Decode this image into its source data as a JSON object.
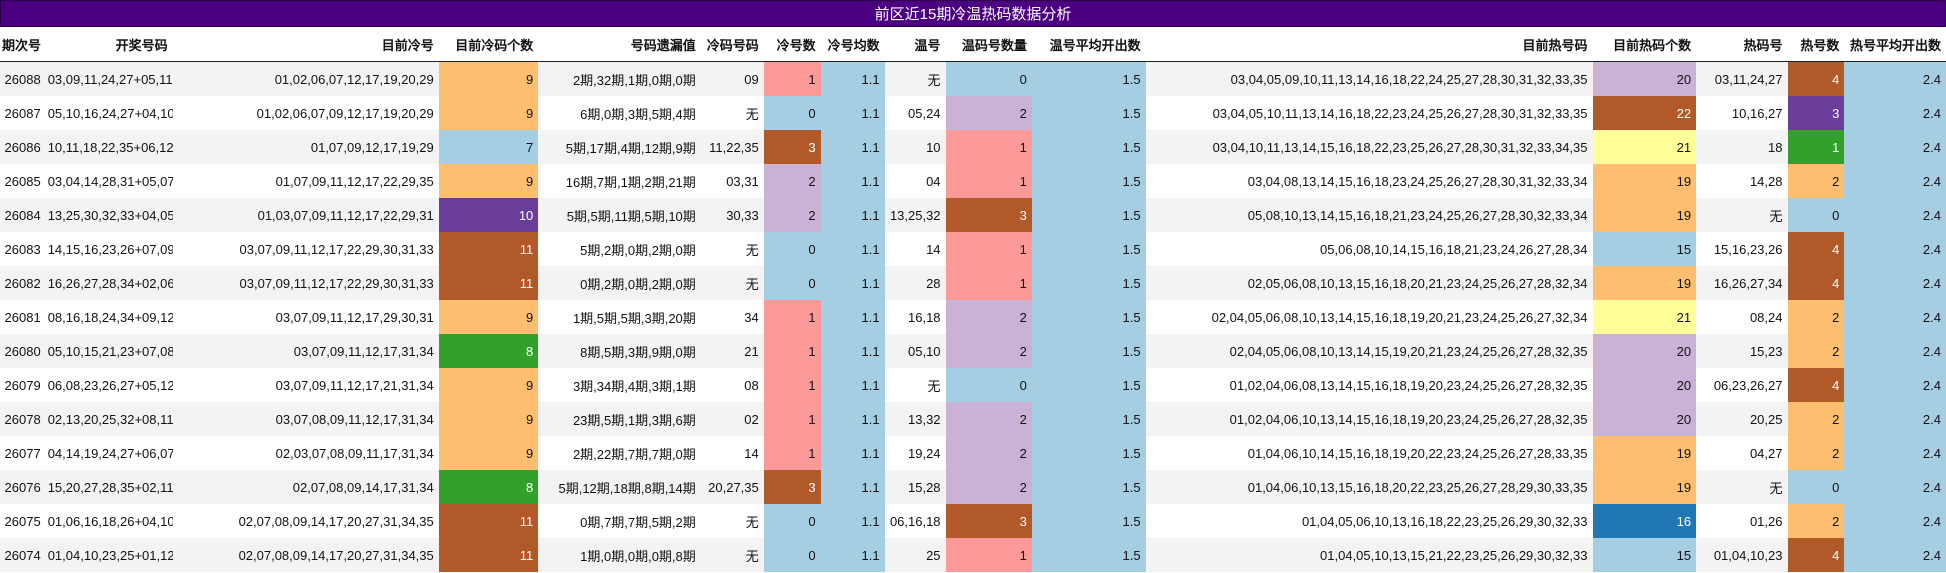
{
  "title": "前区近15期冷温热码数据分析",
  "headers": [
    "期次号",
    "开奖号码",
    "目前冷号",
    "目前冷码个数",
    "号码遗漏值",
    "冷码号码",
    "冷号数",
    "冷号均数",
    "温号",
    "温码号数量",
    "温号平均开出数",
    "目前热号码",
    "目前热码个数",
    "热码号",
    "热号数",
    "热号平均开出数"
  ],
  "colors": {
    "orange": "#fdbf6f",
    "light_blue": "#a6cee3",
    "purple": "#6a3d9a",
    "brown": "#b15928",
    "green": "#33a02c",
    "pink": "#fb9a99",
    "lavender": "#cab2d6",
    "yellow": "#ffff99",
    "blue": "#1f78b4"
  },
  "rows": [
    {
      "period": "26088",
      "draw": "03,09,11,24,27+05,11",
      "cold_nums": "01,02,06,07,12,17,19,20,29",
      "cold_count": "9",
      "cold_count_color": "orange",
      "miss": "2期,32期,1期,0期,0期",
      "cold_hit": "09",
      "cold_hit_count": "1",
      "cold_hit_color": "pink",
      "cold_avg": "1.1",
      "warm": "无",
      "warm_count": "0",
      "warm_color": "light_blue",
      "warm_avg": "1.5",
      "hot_nums": "03,04,05,09,10,11,13,14,16,18,22,24,25,27,28,30,31,32,33,35",
      "hot_count": "20",
      "hot_count_color": "lavender",
      "hot_hit": "03,11,24,27",
      "hot_hit_count": "4",
      "hot_hit_color": "brown",
      "hot_avg": "2.4"
    },
    {
      "period": "26087",
      "draw": "05,10,16,24,27+04,10",
      "cold_nums": "01,02,06,07,09,12,17,19,20,29",
      "cold_count": "9",
      "cold_count_color": "orange",
      "miss": "6期,0期,3期,5期,4期",
      "cold_hit": "无",
      "cold_hit_count": "0",
      "cold_hit_color": "light_blue",
      "cold_avg": "1.1",
      "warm": "05,24",
      "warm_count": "2",
      "warm_color": "lavender",
      "warm_avg": "1.5",
      "hot_nums": "03,04,05,10,11,13,14,16,18,22,23,24,25,26,27,28,30,31,32,33,35",
      "hot_count": "22",
      "hot_count_color": "brown",
      "hot_hit": "10,16,27",
      "hot_hit_count": "3",
      "hot_hit_color": "purple",
      "hot_avg": "2.4"
    },
    {
      "period": "26086",
      "draw": "10,11,18,22,35+06,12",
      "cold_nums": "01,07,09,12,17,19,29",
      "cold_count": "7",
      "cold_count_color": "light_blue",
      "miss": "5期,17期,4期,12期,9期",
      "cold_hit": "11,22,35",
      "cold_hit_count": "3",
      "cold_hit_color": "brown",
      "cold_avg": "1.1",
      "warm": "10",
      "warm_count": "1",
      "warm_color": "pink",
      "warm_avg": "1.5",
      "hot_nums": "03,04,10,11,13,14,15,16,18,22,23,25,26,27,28,30,31,32,33,34,35",
      "hot_count": "21",
      "hot_count_color": "yellow",
      "hot_hit": "18",
      "hot_hit_count": "1",
      "hot_hit_color": "green",
      "hot_avg": "2.4"
    },
    {
      "period": "26085",
      "draw": "03,04,14,28,31+05,07",
      "cold_nums": "01,07,09,11,12,17,22,29,35",
      "cold_count": "9",
      "cold_count_color": "orange",
      "miss": "16期,7期,1期,2期,21期",
      "cold_hit": "03,31",
      "cold_hit_count": "2",
      "cold_hit_color": "lavender",
      "cold_avg": "1.1",
      "warm": "04",
      "warm_count": "1",
      "warm_color": "pink",
      "warm_avg": "1.5",
      "hot_nums": "03,04,08,13,14,15,16,18,23,24,25,26,27,28,30,31,32,33,34",
      "hot_count": "19",
      "hot_count_color": "orange",
      "hot_hit": "14,28",
      "hot_hit_count": "2",
      "hot_hit_color": "orange",
      "hot_avg": "2.4"
    },
    {
      "period": "26084",
      "draw": "13,25,30,32,33+04,05",
      "cold_nums": "01,03,07,09,11,12,17,22,29,31",
      "cold_count": "10",
      "cold_count_color": "purple",
      "miss": "5期,5期,11期,5期,10期",
      "cold_hit": "30,33",
      "cold_hit_count": "2",
      "cold_hit_color": "lavender",
      "cold_avg": "1.1",
      "warm": "13,25,32",
      "warm_count": "3",
      "warm_color": "brown",
      "warm_avg": "1.5",
      "hot_nums": "05,08,10,13,14,15,16,18,21,23,24,25,26,27,28,30,32,33,34",
      "hot_count": "19",
      "hot_count_color": "orange",
      "hot_hit": "无",
      "hot_hit_count": "0",
      "hot_hit_color": "light_blue",
      "hot_avg": "2.4"
    },
    {
      "period": "26083",
      "draw": "14,15,16,23,26+07,09",
      "cold_nums": "03,07,09,11,12,17,22,29,30,31,33",
      "cold_count": "11",
      "cold_count_color": "brown",
      "miss": "5期,2期,0期,2期,0期",
      "cold_hit": "无",
      "cold_hit_count": "0",
      "cold_hit_color": "light_blue",
      "cold_avg": "1.1",
      "warm": "14",
      "warm_count": "1",
      "warm_color": "pink",
      "warm_avg": "1.5",
      "hot_nums": "05,06,08,10,14,15,16,18,21,23,24,26,27,28,34",
      "hot_count": "15",
      "hot_count_color": "light_blue",
      "hot_hit": "15,16,23,26",
      "hot_hit_count": "4",
      "hot_hit_color": "brown",
      "hot_avg": "2.4"
    },
    {
      "period": "26082",
      "draw": "16,26,27,28,34+02,06",
      "cold_nums": "03,07,09,11,12,17,22,29,30,31,33",
      "cold_count": "11",
      "cold_count_color": "brown",
      "miss": "0期,2期,0期,2期,0期",
      "cold_hit": "无",
      "cold_hit_count": "0",
      "cold_hit_color": "light_blue",
      "cold_avg": "1.1",
      "warm": "28",
      "warm_count": "1",
      "warm_color": "pink",
      "warm_avg": "1.5",
      "hot_nums": "02,05,06,08,10,13,15,16,18,20,21,23,24,25,26,27,28,32,34",
      "hot_count": "19",
      "hot_count_color": "orange",
      "hot_hit": "16,26,27,34",
      "hot_hit_count": "4",
      "hot_hit_color": "brown",
      "hot_avg": "2.4"
    },
    {
      "period": "26081",
      "draw": "08,16,18,24,34+09,12",
      "cold_nums": "03,07,09,11,12,17,29,30,31",
      "cold_count": "9",
      "cold_count_color": "orange",
      "miss": "1期,5期,5期,3期,20期",
      "cold_hit": "34",
      "cold_hit_count": "1",
      "cold_hit_color": "pink",
      "cold_avg": "1.1",
      "warm": "16,18",
      "warm_count": "2",
      "warm_color": "lavender",
      "warm_avg": "1.5",
      "hot_nums": "02,04,05,06,08,10,13,14,15,16,18,19,20,21,23,24,25,26,27,32,34",
      "hot_count": "21",
      "hot_count_color": "yellow",
      "hot_hit": "08,24",
      "hot_hit_count": "2",
      "hot_hit_color": "orange",
      "hot_avg": "2.4"
    },
    {
      "period": "26080",
      "draw": "05,10,15,21,23+07,08",
      "cold_nums": "03,07,09,11,12,17,31,34",
      "cold_count": "8",
      "cold_count_color": "green",
      "miss": "8期,5期,3期,9期,0期",
      "cold_hit": "21",
      "cold_hit_count": "1",
      "cold_hit_color": "pink",
      "cold_avg": "1.1",
      "warm": "05,10",
      "warm_count": "2",
      "warm_color": "lavender",
      "warm_avg": "1.5",
      "hot_nums": "02,04,05,06,08,10,13,14,15,19,20,21,23,24,25,26,27,28,32,35",
      "hot_count": "20",
      "hot_count_color": "lavender",
      "hot_hit": "15,23",
      "hot_hit_count": "2",
      "hot_hit_color": "orange",
      "hot_avg": "2.4"
    },
    {
      "period": "26079",
      "draw": "06,08,23,26,27+05,12",
      "cold_nums": "03,07,09,11,12,17,21,31,34",
      "cold_count": "9",
      "cold_count_color": "orange",
      "miss": "3期,34期,4期,3期,1期",
      "cold_hit": "08",
      "cold_hit_count": "1",
      "cold_hit_color": "pink",
      "cold_avg": "1.1",
      "warm": "无",
      "warm_count": "0",
      "warm_color": "light_blue",
      "warm_avg": "1.5",
      "hot_nums": "01,02,04,06,08,13,14,15,16,18,19,20,23,24,25,26,27,28,32,35",
      "hot_count": "20",
      "hot_count_color": "lavender",
      "hot_hit": "06,23,26,27",
      "hot_hit_count": "4",
      "hot_hit_color": "brown",
      "hot_avg": "2.4"
    },
    {
      "period": "26078",
      "draw": "02,13,20,25,32+08,11",
      "cold_nums": "03,07,08,09,11,12,17,31,34",
      "cold_count": "9",
      "cold_count_color": "orange",
      "miss": "23期,5期,1期,3期,6期",
      "cold_hit": "02",
      "cold_hit_count": "1",
      "cold_hit_color": "pink",
      "cold_avg": "1.1",
      "warm": "13,32",
      "warm_count": "2",
      "warm_color": "lavender",
      "warm_avg": "1.5",
      "hot_nums": "01,02,04,06,10,13,14,15,16,18,19,20,23,24,25,26,27,28,32,35",
      "hot_count": "20",
      "hot_count_color": "lavender",
      "hot_hit": "20,25",
      "hot_hit_count": "2",
      "hot_hit_color": "orange",
      "hot_avg": "2.4"
    },
    {
      "period": "26077",
      "draw": "04,14,19,24,27+06,07",
      "cold_nums": "02,03,07,08,09,11,17,31,34",
      "cold_count": "9",
      "cold_count_color": "orange",
      "miss": "2期,22期,7期,7期,0期",
      "cold_hit": "14",
      "cold_hit_count": "1",
      "cold_hit_color": "pink",
      "cold_avg": "1.1",
      "warm": "19,24",
      "warm_count": "2",
      "warm_color": "lavender",
      "warm_avg": "1.5",
      "hot_nums": "01,04,06,10,14,15,16,18,19,20,22,23,24,25,26,27,28,33,35",
      "hot_count": "19",
      "hot_count_color": "orange",
      "hot_hit": "04,27",
      "hot_hit_count": "2",
      "hot_hit_color": "orange",
      "hot_avg": "2.4"
    },
    {
      "period": "26076",
      "draw": "15,20,27,28,35+02,11",
      "cold_nums": "02,07,08,09,14,17,31,34",
      "cold_count": "8",
      "cold_count_color": "green",
      "miss": "5期,12期,18期,8期,14期",
      "cold_hit": "20,27,35",
      "cold_hit_count": "3",
      "cold_hit_color": "brown",
      "cold_avg": "1.1",
      "warm": "15,28",
      "warm_count": "2",
      "warm_color": "lavender",
      "warm_avg": "1.5",
      "hot_nums": "01,04,06,10,13,15,16,18,20,22,23,25,26,27,28,29,30,33,35",
      "hot_count": "19",
      "hot_count_color": "orange",
      "hot_hit": "无",
      "hot_hit_count": "0",
      "hot_hit_color": "light_blue",
      "hot_avg": "2.4"
    },
    {
      "period": "26075",
      "draw": "01,06,16,18,26+04,10",
      "cold_nums": "02,07,08,09,14,17,20,27,31,34,35",
      "cold_count": "11",
      "cold_count_color": "brown",
      "miss": "0期,7期,7期,5期,2期",
      "cold_hit": "无",
      "cold_hit_count": "0",
      "cold_hit_color": "light_blue",
      "cold_avg": "1.1",
      "warm": "06,16,18",
      "warm_count": "3",
      "warm_color": "brown",
      "warm_avg": "1.5",
      "hot_nums": "01,04,05,06,10,13,16,18,22,23,25,26,29,30,32,33",
      "hot_count": "16",
      "hot_count_color": "blue",
      "hot_hit": "01,26",
      "hot_hit_count": "2",
      "hot_hit_color": "orange",
      "hot_avg": "2.4"
    },
    {
      "period": "26074",
      "draw": "01,04,10,23,25+01,12",
      "cold_nums": "02,07,08,09,14,17,20,27,31,34,35",
      "cold_count": "11",
      "cold_count_color": "brown",
      "miss": "1期,0期,0期,0期,8期",
      "cold_hit": "无",
      "cold_hit_count": "0",
      "cold_hit_color": "light_blue",
      "cold_avg": "1.1",
      "warm": "25",
      "warm_count": "1",
      "warm_color": "pink",
      "warm_avg": "1.5",
      "hot_nums": "01,04,05,10,13,15,21,22,23,25,26,29,30,32,33",
      "hot_count": "15",
      "hot_count_color": "light_blue",
      "hot_hit": "01,04,10,23",
      "hot_hit_count": "4",
      "hot_hit_color": "brown",
      "hot_avg": "2.4"
    }
  ]
}
